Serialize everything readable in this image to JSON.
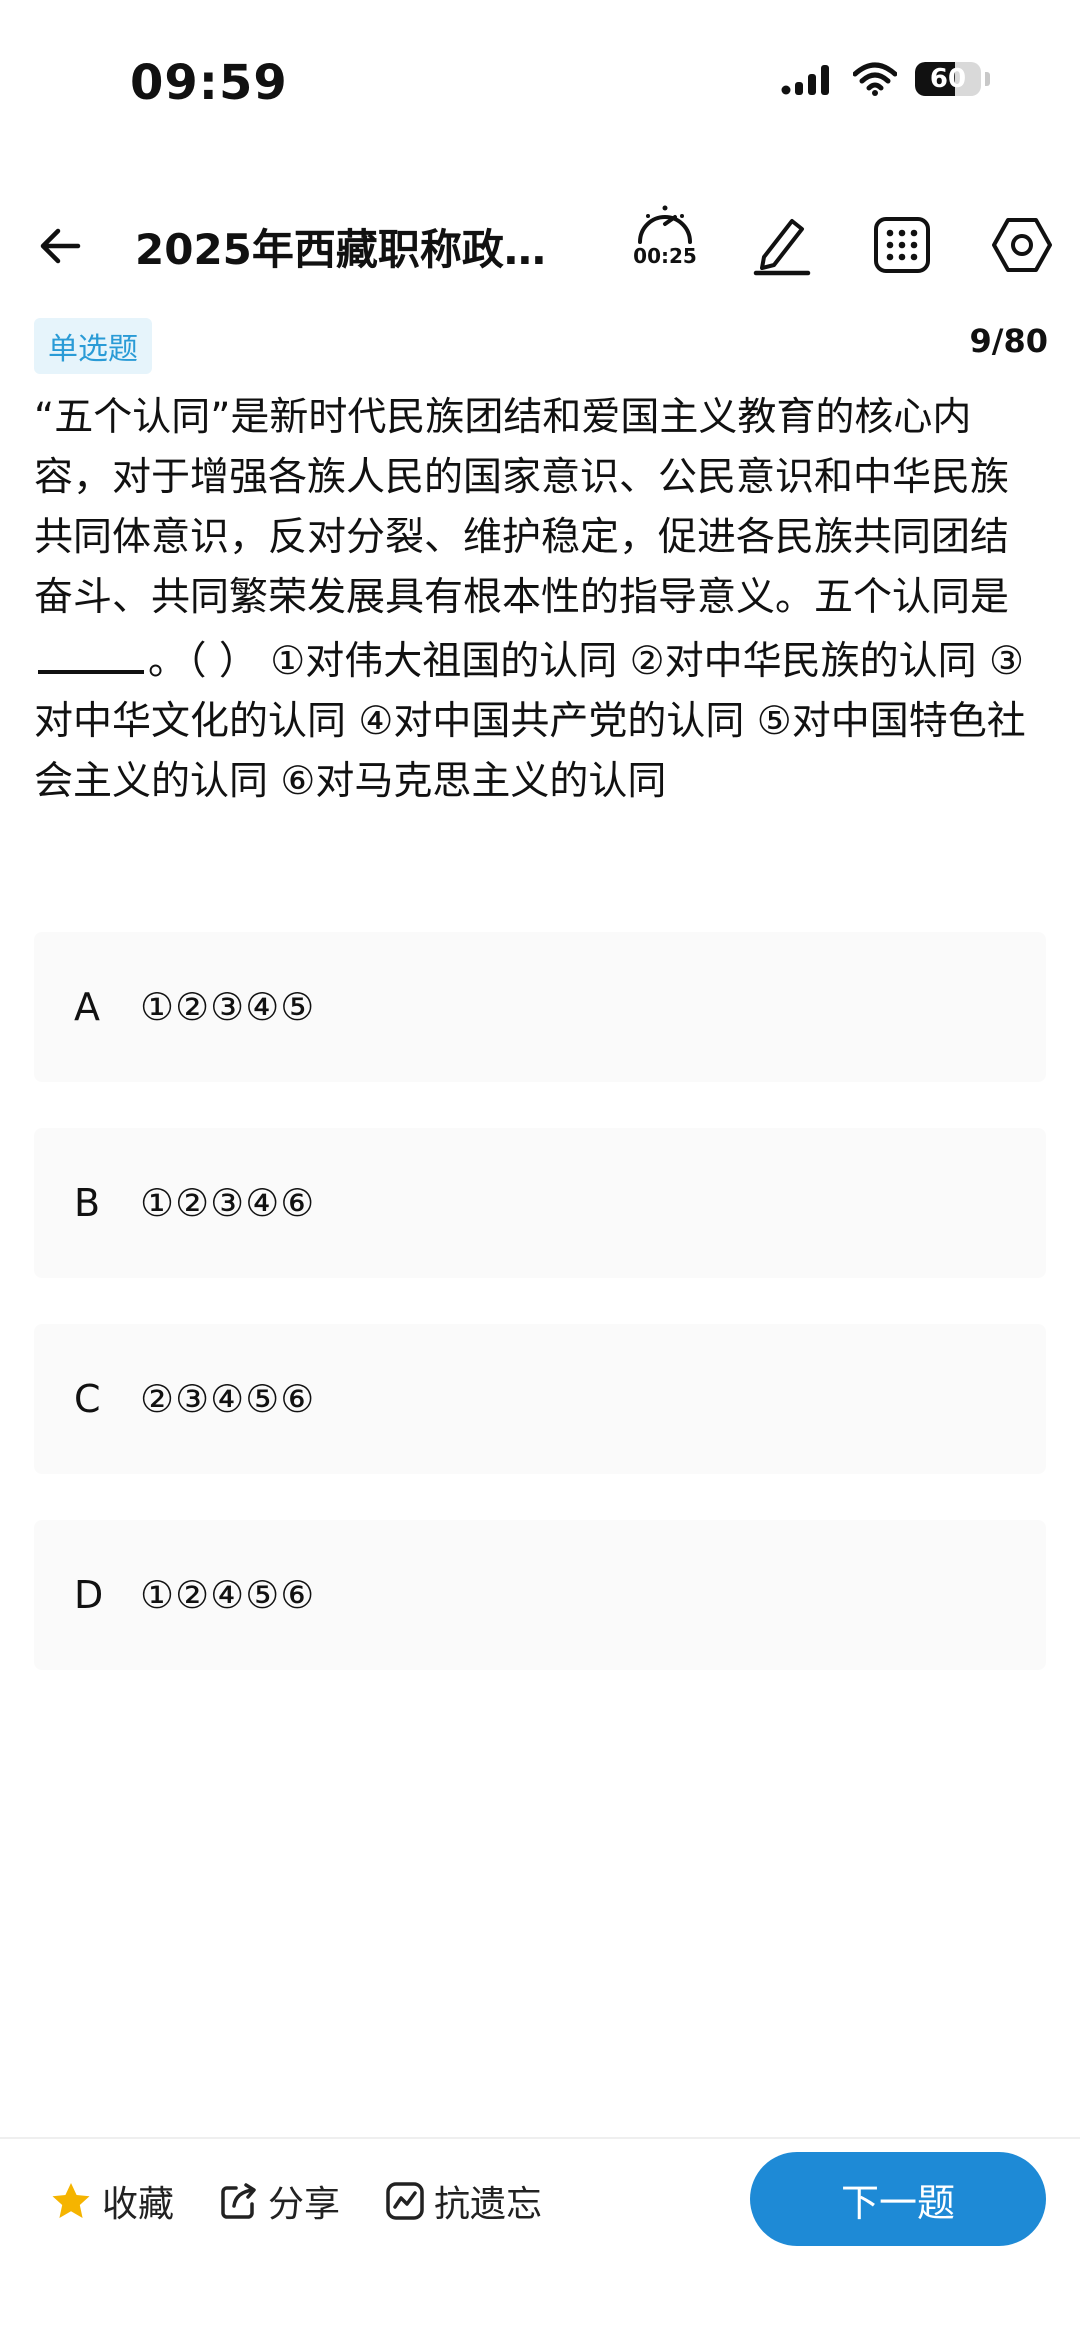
{
  "status_bar": {
    "time": "09:59",
    "battery_level": 60,
    "battery_label": "60"
  },
  "header": {
    "title": "2025年西藏职称政…",
    "timer": "00:25"
  },
  "question": {
    "type": "单选题",
    "progress": "9/80",
    "text_before_blank": "“五个认同”是新时代民族团结和爱国主义教育的核心内容，对于增强各族人民的国家意识、公民意识和中华民族共同体意识，反对分裂、维护稳定，促进各民族共同团结奋斗、共同繁荣发展具有根本性的指导意义。五个认同是",
    "text_after_blank": "。（ ） ①对伟大祖国的认同 ②对中华民族的认同 ③对中华文化的认同 ④对中国共产党的认同 ⑤对中国特色社会主义的认同 ⑥对马克思主义的认同"
  },
  "options": [
    {
      "letter": "A",
      "text": "①②③④⑤"
    },
    {
      "letter": "B",
      "text": "①②③④⑥"
    },
    {
      "letter": "C",
      "text": "②③④⑤⑥"
    },
    {
      "letter": "D",
      "text": "①②④⑤⑥"
    }
  ],
  "bottom_bar": {
    "favorite_label": "收藏",
    "share_label": "分享",
    "anti_forget_label": "抗遗忘",
    "next_label": "下一题"
  },
  "colors": {
    "accent": "#1e8ad6",
    "badge_bg": "#e6f4fb",
    "badge_text": "#2a9bd6",
    "star": "#f5b400",
    "option_bg": "#fafafa"
  },
  "icons": {
    "back": "arrow-left-icon",
    "timer": "stopwatch-icon",
    "edit": "pen-icon",
    "grid": "grid-icon",
    "settings": "hexagon-settings-icon",
    "favorite": "star-icon",
    "share": "share-icon",
    "anti_forget": "chart-icon"
  }
}
